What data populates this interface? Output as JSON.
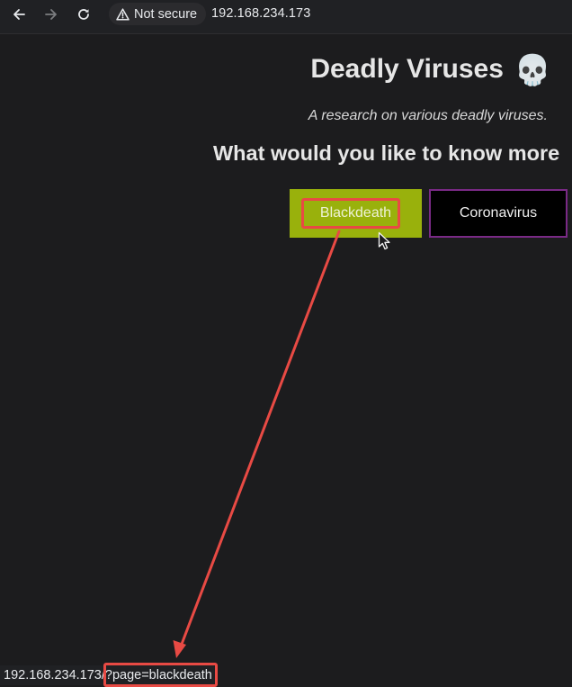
{
  "browser": {
    "nav": {
      "back_icon": "arrow-left-icon",
      "forward_icon": "arrow-right-icon",
      "reload_icon": "reload-icon"
    },
    "security": {
      "icon": "warning-triangle-icon",
      "label": "Not secure"
    },
    "url": "192.168.234.173"
  },
  "page": {
    "title": "Deadly Viruses",
    "title_icon": "💀",
    "subtitle": "A research on various deadly viruses.",
    "question": "What would you like to know more",
    "buttons": [
      {
        "label": "Blackdeath",
        "color": "#99b10c"
      },
      {
        "label": "Coronavirus",
        "color": "#000000",
        "border": "#7a2a86"
      }
    ]
  },
  "status_bar": {
    "link": "192.168.234.173/?page=blackdeath"
  },
  "annotation": {
    "color": "#e84a44"
  },
  "theme": {
    "background": "#1c1c1e",
    "toolbar": "#202124"
  }
}
